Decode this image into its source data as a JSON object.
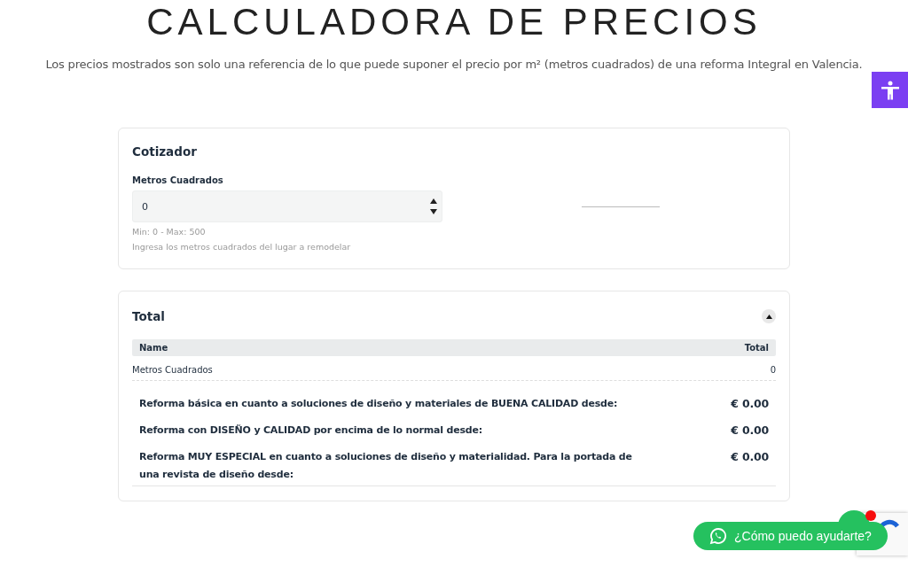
{
  "header": {
    "title": "CALCULADORA DE PRECIOS",
    "subtitle": "Los precios mostrados son solo una referencia de lo que puede suponer el precio por m² (metros cuadrados) de una reforma Integral en Valencia."
  },
  "cotizador": {
    "title": "Cotizador",
    "field": {
      "label": "Metros Cuadrados",
      "value": "0",
      "range": "Min: 0 - Max: 500",
      "help": "Ingresa los metros cuadrados del lugar a remodelar"
    }
  },
  "total": {
    "title": "Total",
    "expanded": true,
    "columns": [
      "Name",
      "Total"
    ],
    "rows": [
      {
        "name": "Metros Cuadrados",
        "total": "0"
      }
    ],
    "prices": [
      {
        "label": "Reforma básica en cuanto a soluciones de diseño y materiales de BUENA CALIDAD desde:",
        "amount": "€ 0.00"
      },
      {
        "label": "Reforma con DISEÑO y CALIDAD por encima de lo normal desde:",
        "amount": "€ 0.00"
      },
      {
        "label": "Reforma MUY ESPECIAL en cuanto a soluciones de diseño y materialidad. Para la portada de una revista de diseño desde:",
        "amount": "€ 0.00"
      }
    ]
  },
  "chat": {
    "label": "¿Cómo puedo ayudarte?",
    "notification": true
  }
}
